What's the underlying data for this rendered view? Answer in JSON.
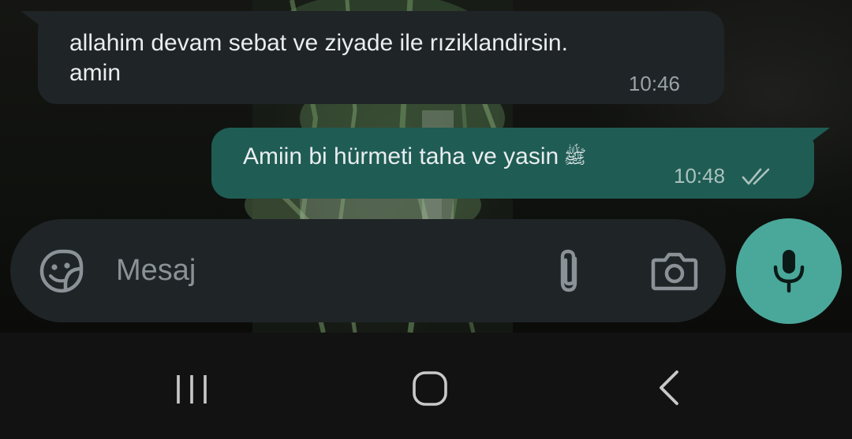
{
  "chat": {
    "messages": [
      {
        "direction": "incoming",
        "text_line1": "allahim devam sebat ve ziyade ile rıziklandirsin.",
        "text_line2": "amin",
        "time": "10:46"
      },
      {
        "direction": "outgoing",
        "text": "Amiin bi hürmeti taha ve yasin",
        "honorific": "ﷺ",
        "time": "10:48",
        "status": "delivered-double-check"
      }
    ]
  },
  "composer": {
    "placeholder": "Mesaj",
    "emoji_icon": "sticker-emoji-icon",
    "attach_icon": "paperclip-icon",
    "camera_icon": "camera-icon",
    "mic_icon": "microphone-icon"
  },
  "navigation": {
    "recents_icon": "recents-icon",
    "home_icon": "home-icon",
    "back_icon": "back-icon"
  },
  "colors": {
    "incoming_bubble": "#1f2427",
    "outgoing_bubble": "#1f5c54",
    "accent": "#4aa89a",
    "text": "#e9edef",
    "nav_background": "#121212"
  }
}
